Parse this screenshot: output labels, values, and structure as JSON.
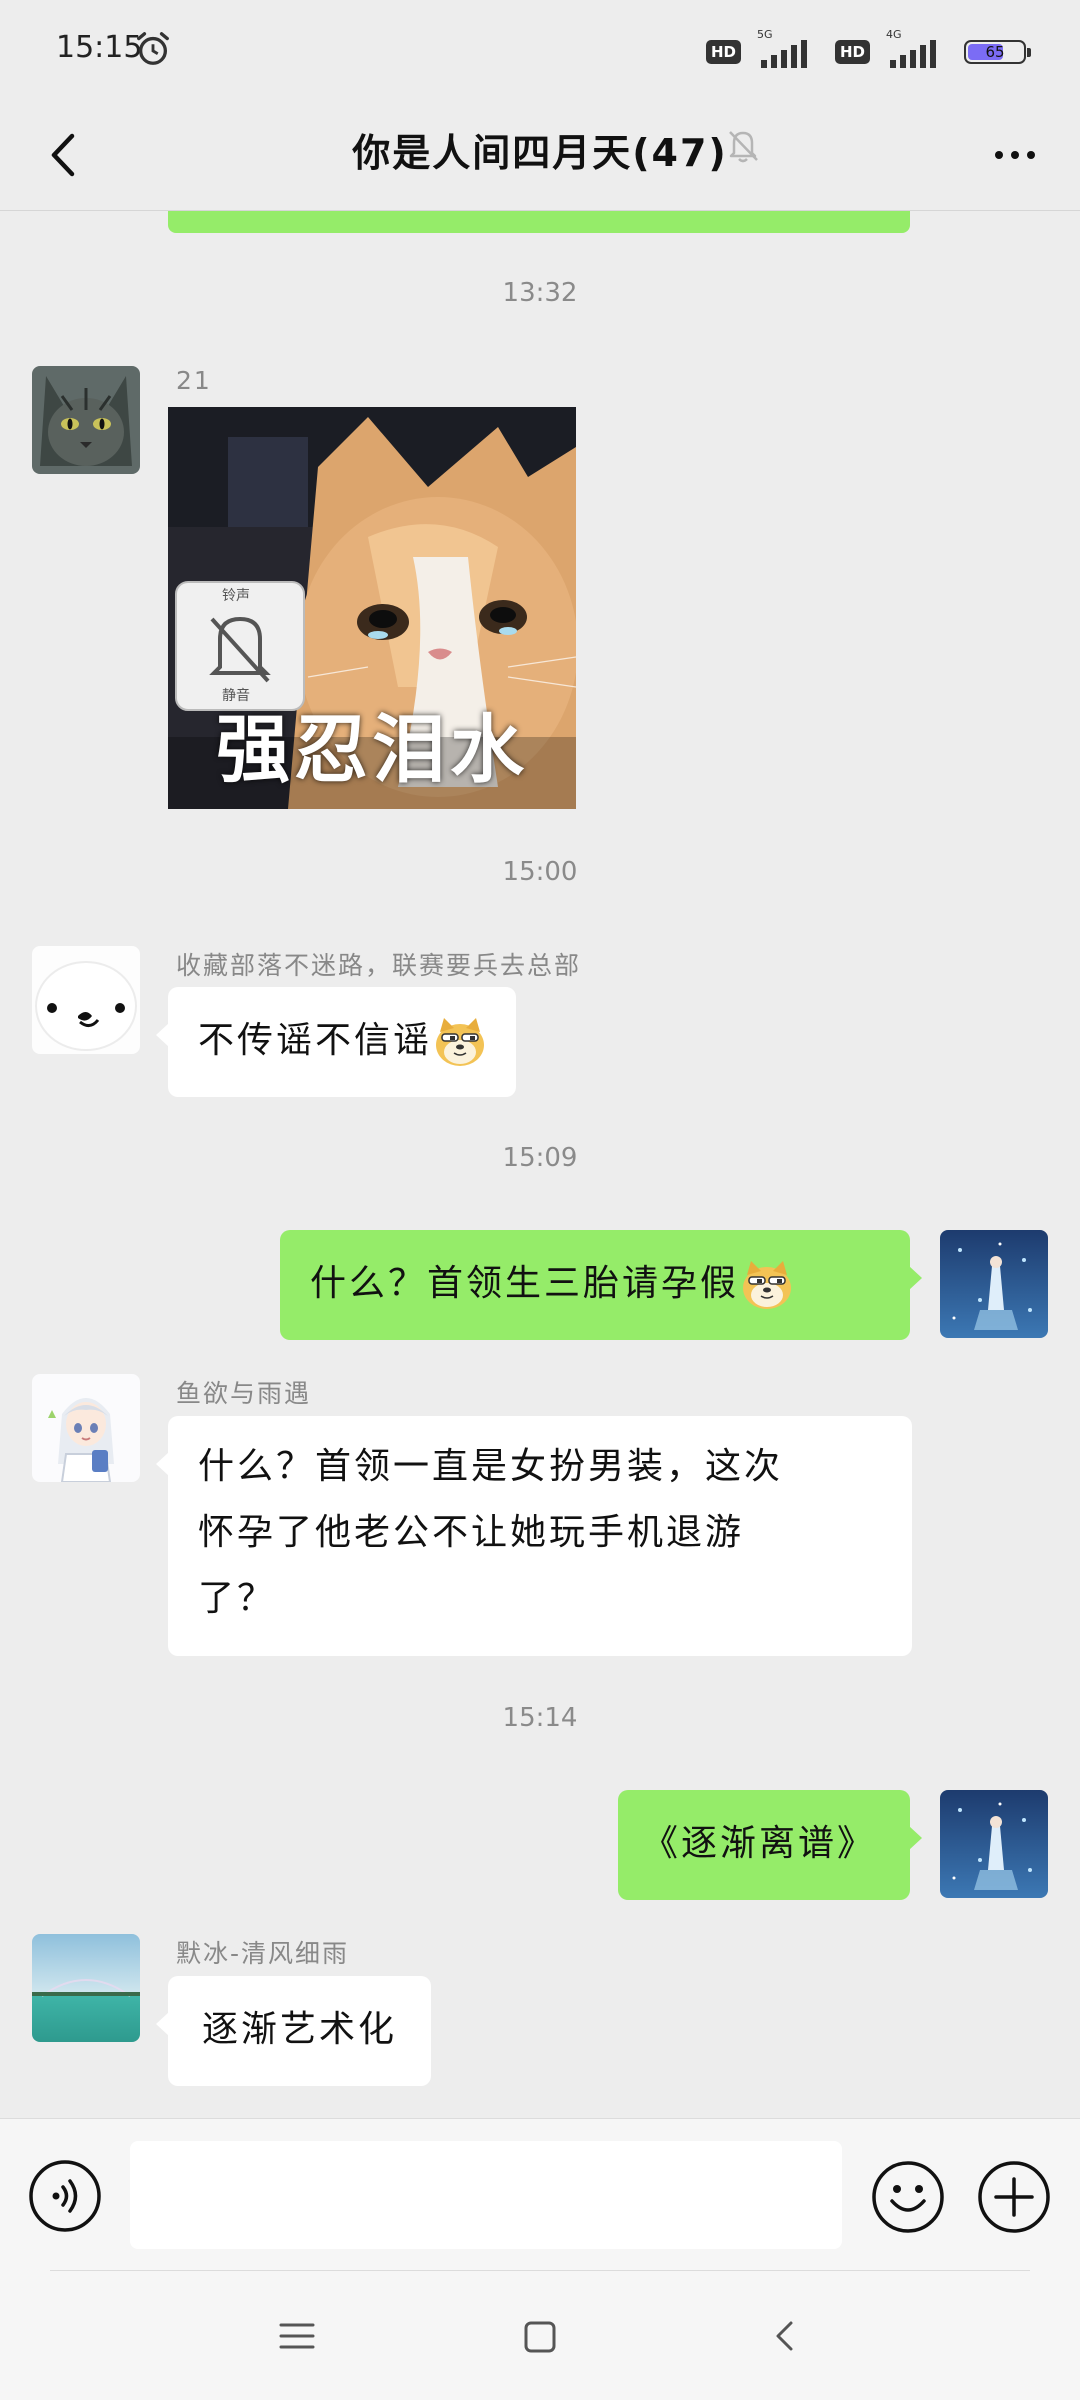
{
  "status_bar": {
    "time": "15:15",
    "network_1": "5G",
    "network_2": "4G",
    "hd_label": "HD",
    "battery_level": 65,
    "battery_label": "65"
  },
  "header": {
    "title": "你是人间四月天(47)",
    "back_icon": "chevron-left-icon",
    "mute_icon": "bell-off-icon",
    "more_icon": "more-dots-icon"
  },
  "colors": {
    "background": "#ededed",
    "outgoing_bubble": "#95ec69",
    "incoming_bubble": "#ffffff",
    "timestamp_text": "#8a8a8a"
  },
  "messages": [
    {
      "type": "timestamp",
      "text": "13:32"
    },
    {
      "type": "incoming_image",
      "sender": "21",
      "caption": "强忍泪水",
      "icon_top": "铃声",
      "icon_bottom": "静音"
    },
    {
      "type": "timestamp",
      "text": "15:00"
    },
    {
      "type": "incoming_text",
      "sender": "收藏部落不迷路，联赛要兵去总部",
      "text": "不传谣不信谣",
      "emoji": "doge"
    },
    {
      "type": "timestamp",
      "text": "15:09"
    },
    {
      "type": "outgoing_text",
      "text": "什么？首领生三胎请孕假",
      "emoji": "doge"
    },
    {
      "type": "incoming_text",
      "sender": "鱼欲与雨遇",
      "lines": [
        "什么？首领一直是女扮男装，这次",
        "怀孕了他老公不让她玩手机退游",
        "了？"
      ]
    },
    {
      "type": "timestamp",
      "text": "15:14"
    },
    {
      "type": "outgoing_text",
      "text": "《逐渐离谱》"
    },
    {
      "type": "incoming_text",
      "sender": "默冰-清风细雨",
      "text": "逐渐艺术化"
    }
  ],
  "input_bar": {
    "placeholder": "",
    "voice_icon": "voice-icon",
    "emoji_icon": "smiley-icon",
    "plus_icon": "plus-icon"
  },
  "nav_bar": {
    "menu_icon": "menu-icon",
    "home_icon": "home-icon",
    "back_icon": "back-icon"
  }
}
